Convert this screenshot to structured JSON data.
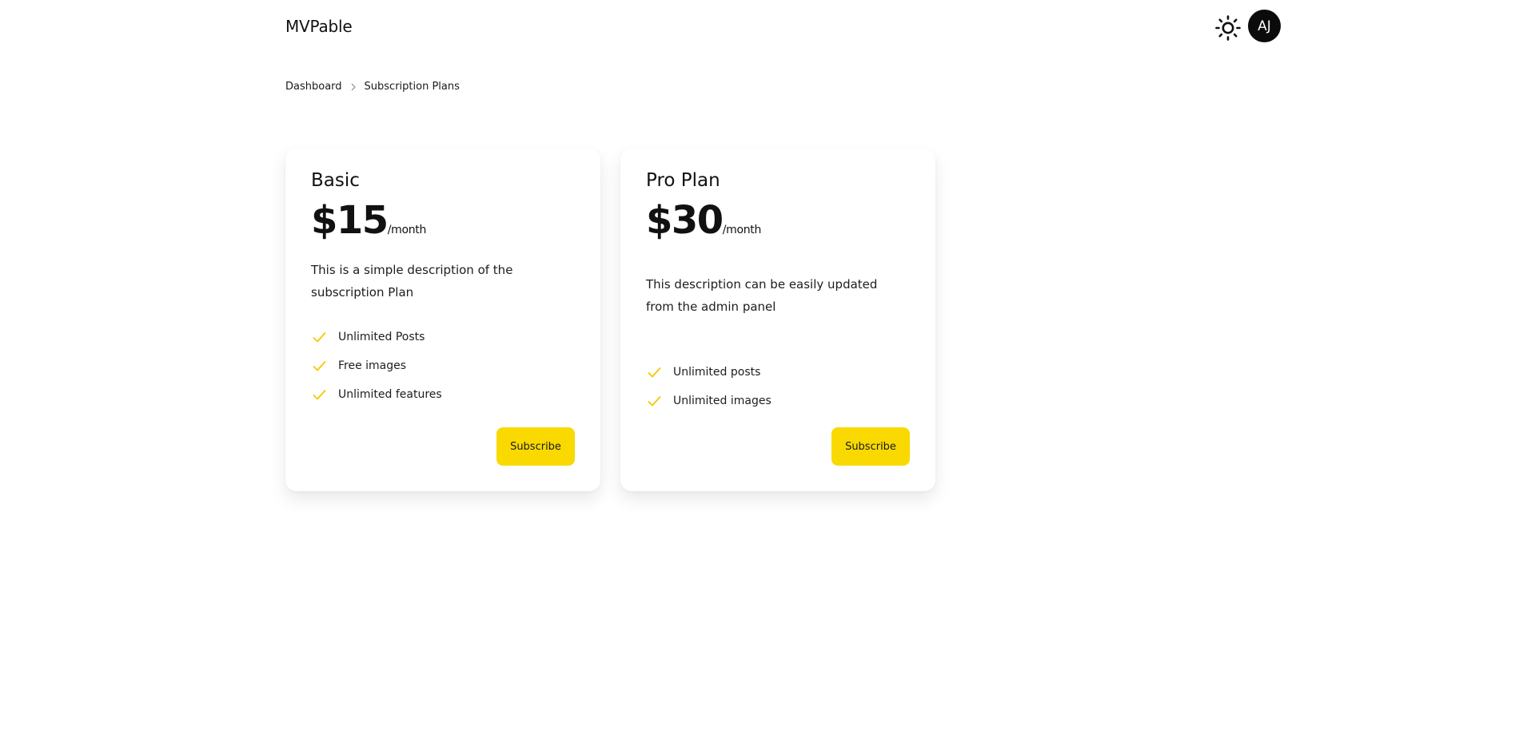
{
  "header": {
    "brand": "MVPable",
    "theme_icon": "sun-icon",
    "avatar_initials": "AJ"
  },
  "breadcrumb": {
    "items": [
      "Dashboard",
      "Subscription Plans"
    ],
    "separator_icon": "chevron-right-icon"
  },
  "colors": {
    "accent": "#F9D900",
    "check": "#F5C800",
    "avatar_bg": "#0B0B0B"
  },
  "plans": [
    {
      "name": "Basic",
      "price": "$15",
      "period": "/month",
      "description": "This is a simple description of the subscription Plan",
      "features": [
        "Unlimited Posts",
        "Free images",
        "Unlimited features"
      ],
      "button_label": "Subscribe"
    },
    {
      "name": "Pro Plan",
      "price": "$30",
      "period": "/month",
      "description": "This description can be easily updated from the admin panel",
      "features": [
        "Unlimited posts",
        "Unlimited images"
      ],
      "button_label": "Subscribe"
    }
  ]
}
